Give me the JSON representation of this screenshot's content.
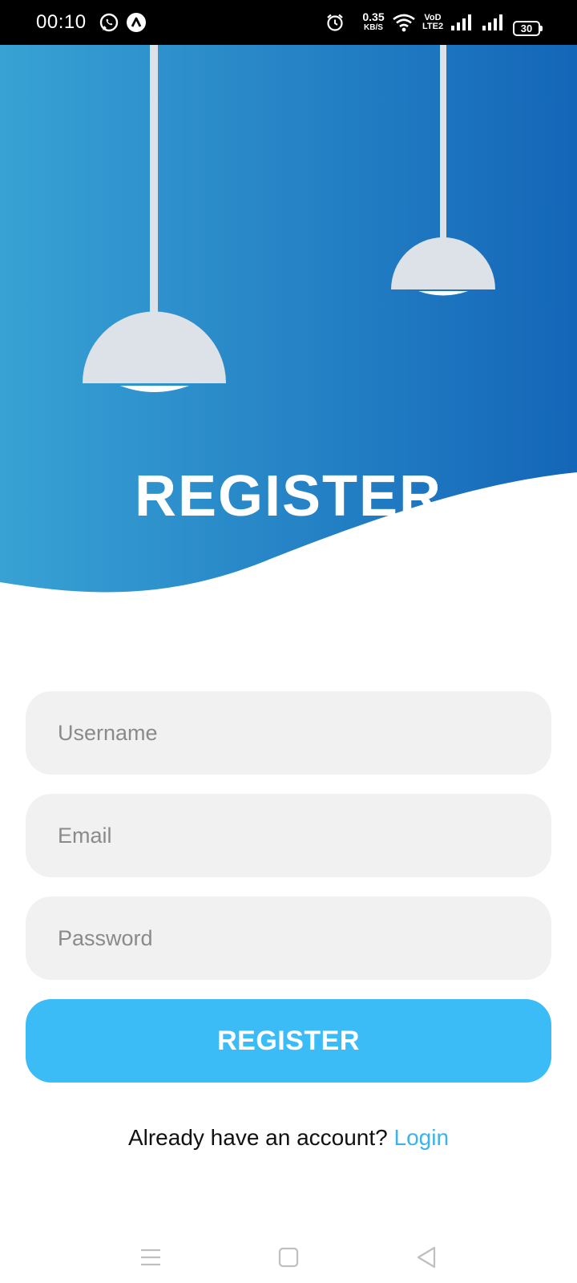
{
  "status_bar": {
    "time": "00:10",
    "net_speed_value": "0.35",
    "net_speed_unit": "KB/S",
    "volte_top": "VoD",
    "volte_bottom": "LTE2",
    "battery": "30",
    "icons": [
      "whatsapp-icon",
      "app-notification-icon",
      "alarm-icon",
      "wifi-icon",
      "volte-icon",
      "signal-icon",
      "signal-icon",
      "battery-icon"
    ]
  },
  "header": {
    "title": "REGISTER",
    "gradient_start": "#38a2d4",
    "gradient_end": "#1466b8",
    "lamp_color": "#dde1e8"
  },
  "form": {
    "username_placeholder": "Username",
    "email_placeholder": "Email",
    "password_placeholder": "Password",
    "submit_label": "REGISTER",
    "field_bg": "#f1f1f1",
    "button_color": "#3bbcf6"
  },
  "footer": {
    "prompt_text": "Already have an account?",
    "login_link": "Login",
    "link_color": "#3bb2e8"
  },
  "nav_bar": {
    "icons": [
      "menu-icon",
      "home-icon",
      "back-icon"
    ]
  }
}
